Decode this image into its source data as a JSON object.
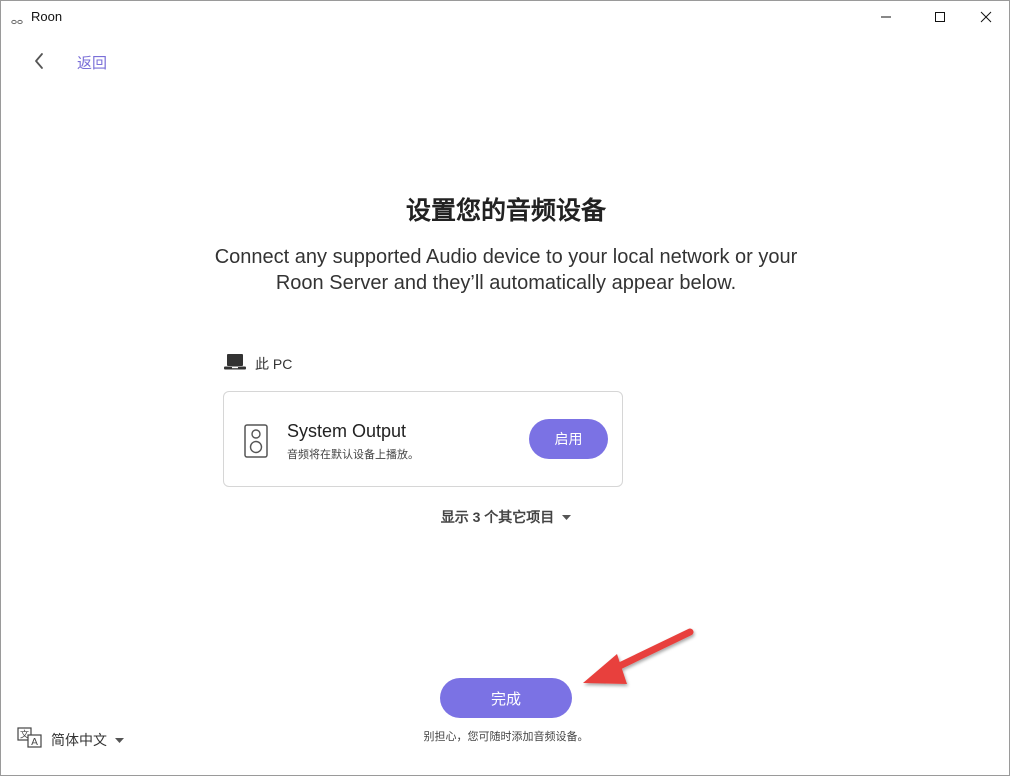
{
  "window": {
    "title": "Roon",
    "controls": {
      "minimize": "minimize-icon",
      "maximize": "maximize-icon",
      "close": "close-icon"
    }
  },
  "nav": {
    "back_label": "返回"
  },
  "main": {
    "title": "设置您的音频设备",
    "subtitle": "Connect any supported Audio device to your local network or your Roon Server and they’ll automatically appear below."
  },
  "section": {
    "icon": "laptop-icon",
    "label": "此 PC"
  },
  "device": {
    "icon": "speaker-icon",
    "name": "System Output",
    "description": "音频将在默认设备上播放。",
    "enable_label": "启用"
  },
  "show_more": {
    "label": "显示 3 个其它项目"
  },
  "footer": {
    "finish_label": "完成",
    "note": "别担心，您可随时添加音频设备。"
  },
  "language": {
    "icon": "translate-icon",
    "selected": "简体中文"
  },
  "colors": {
    "accent": "#7b72e4",
    "link": "#7a6fd8",
    "annotation": "#e8413c"
  }
}
